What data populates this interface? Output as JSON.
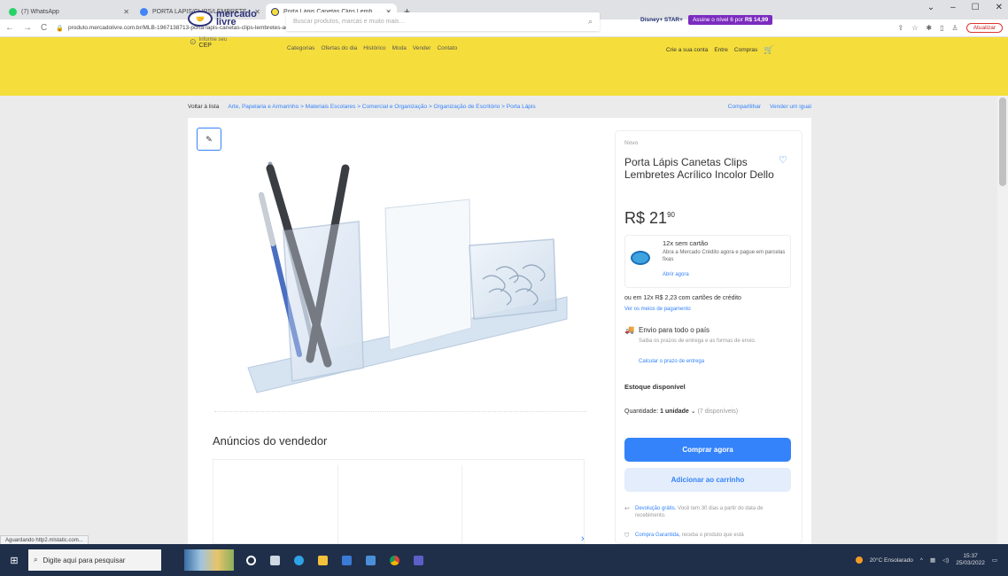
{
  "browser": {
    "tabs": [
      {
        "label": "(7) WhatsApp",
        "icon_color": "#25d366",
        "active": false
      },
      {
        "label": "PORTA LAPIS/CLIPS/LEMBRETE",
        "icon_color": "#4285f4",
        "active": false
      },
      {
        "label": "Porta Lápis Canetas Clips Lemb",
        "icon_color": "#f5de3b",
        "active": true
      }
    ],
    "new_tab": "+",
    "url": "produto.mercadolivre.com.br/MLB-1967138713-porta-lapis-canetas-clips-lembretes-acrilico-incolor-dello-_JM#matt_tool=18956390&utm_source=google_shopping&utm_medium=organic",
    "update_label": "Atualizar"
  },
  "header": {
    "logo_line1": "mercado",
    "logo_line2": "livre",
    "search_placeholder": "Buscar produtos, marcas e muito mais…",
    "disney": "Disney+ STAR+",
    "promo": "Assine o nível 6 por",
    "promo_price": "R$ 14,99",
    "cep_label": "Informe seu",
    "cep_value": "CEP",
    "nav": [
      "Categorias",
      "Ofertas do dia",
      "Histórico",
      "Moda",
      "Vender",
      "Contato"
    ],
    "user": [
      "Crie a sua conta",
      "Entre",
      "Compras"
    ]
  },
  "breadcrumb": {
    "back": "Voltar à lista",
    "path": "Arte, Papelaria e Armarinho > Materiais Escolares > Comercial e Organização > Organização de Escritório > Porta Lápis",
    "share": "Compartilhar",
    "sell": "Vender um igual"
  },
  "product": {
    "condition": "Novo",
    "title": "Porta Lápis Canetas Clips Lembretes Acrílico Incolor Dello",
    "currency": "R$",
    "price_int": "21",
    "price_cents": "90",
    "credit_title": "12x sem cartão",
    "credit_desc": "Abra a Mercado Crédito agora e pague em parcelas fixas",
    "credit_link": "Abrir agora",
    "installments": "ou em 12x R$ 2,23 com cartões de crédito",
    "payment_link": "Ver os meios de pagamento",
    "shipping_title": "Envio para todo o país",
    "shipping_desc": "Saiba os prazos de entrega e as formas de envio.",
    "shipping_link": "Calcular o prazo de entrega",
    "stock": "Estoque disponível",
    "qty_label": "Quantidade:",
    "qty_value": "1 unidade",
    "qty_available": "(7 disponíveis)",
    "buy": "Comprar agora",
    "add_cart": "Adicionar ao carrinho",
    "return_link": "Devolução grátis.",
    "return_text": "Você tem 30 dias a partir do data de recebimento.",
    "guarantee_link": "Compra Garantida,",
    "guarantee_text": "receba o produto que está"
  },
  "seller": {
    "title": "Anúncios do vendedor"
  },
  "status": {
    "text": "Aguardando http2.mlstatic.com..."
  },
  "taskbar": {
    "search": "Digite aqui para pesquisar",
    "weather": "20°C Ensolarado",
    "time": "15:37",
    "date": "25/03/2022"
  },
  "colors": {
    "ml_yellow": "#f5de3b",
    "ml_blue": "#3483fa"
  }
}
